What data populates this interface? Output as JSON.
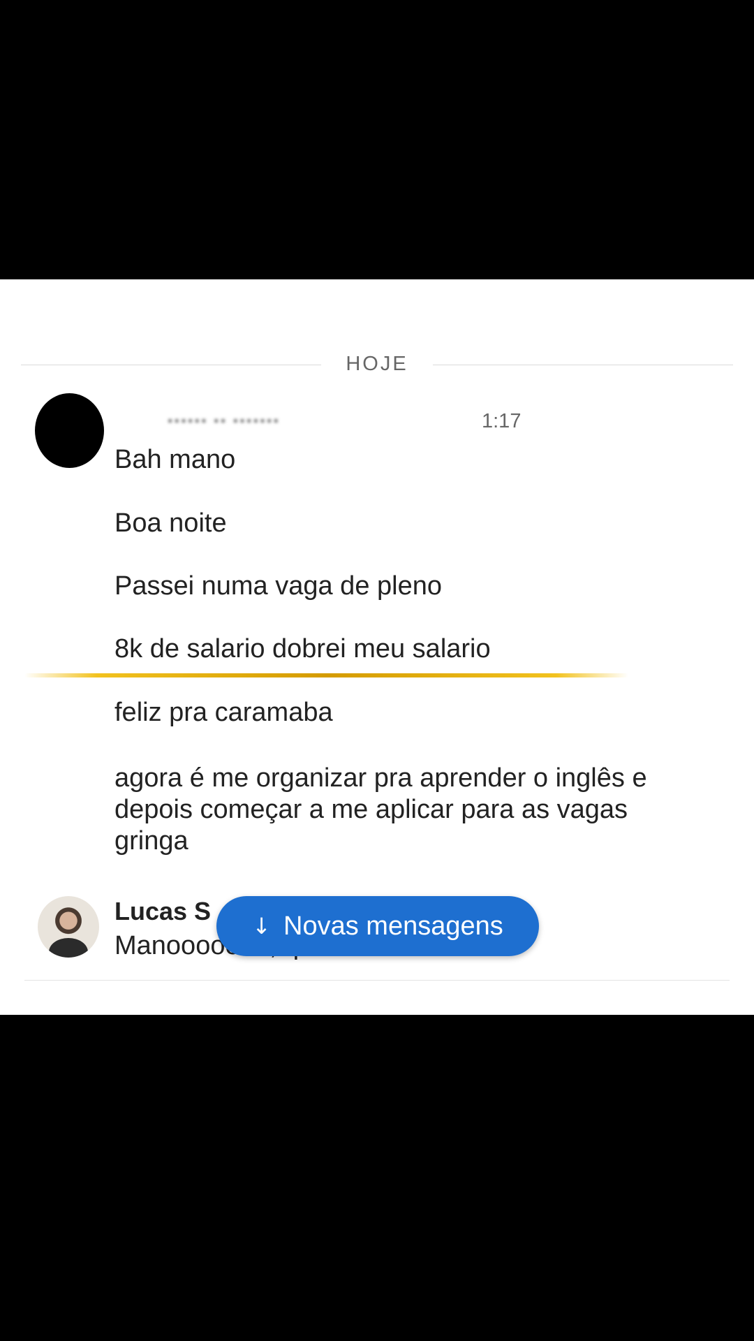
{
  "divider": {
    "label": "HOJE"
  },
  "message_group_1": {
    "sender_name": "······ ·· ·······",
    "time": "1:17",
    "messages": [
      "Bah mano",
      "Boa noite",
      "Passei numa vaga de pleno",
      "8k de salario dobrei meu salario",
      "feliz pra caramaba",
      "agora é me organizar pra aprender o inglês e depois começar a me aplicar para as vagas gringa"
    ]
  },
  "message_group_2": {
    "sender_name": "Lucas S",
    "message": "Manooooooo, que massa"
  },
  "new_messages_button": {
    "icon": "arrow-down-icon",
    "label": "Novas mensagens",
    "color": "#1e6fd0"
  },
  "colors": {
    "highlight_line": "#d49b00"
  }
}
